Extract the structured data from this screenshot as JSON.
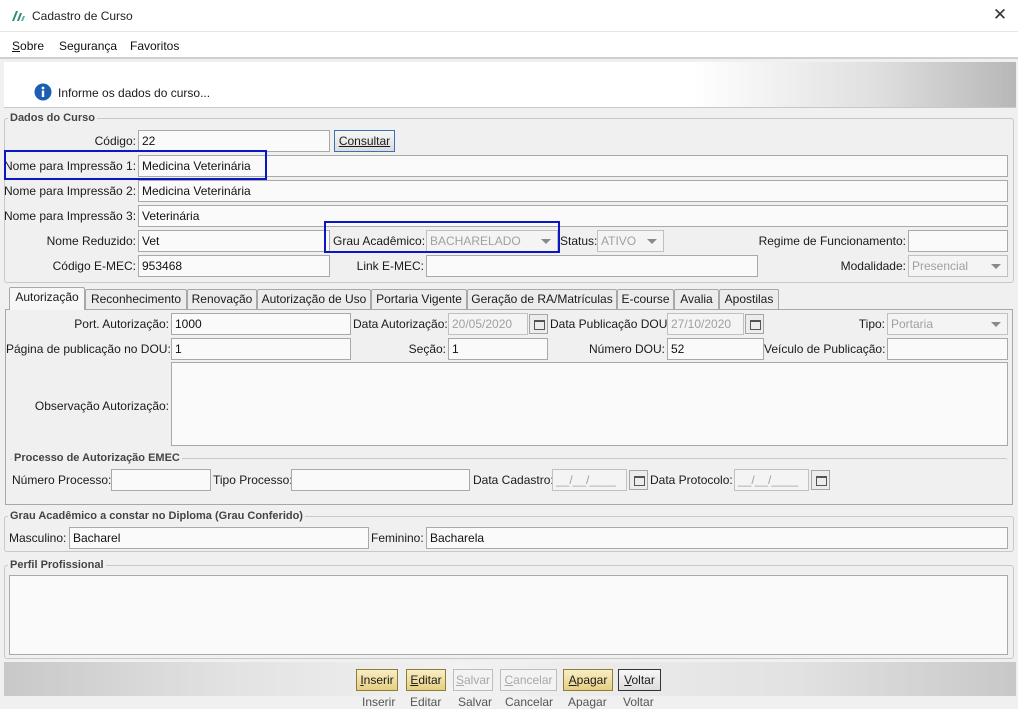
{
  "window": {
    "title": "Cadastro de Curso",
    "close_symbol": "✕"
  },
  "menu": [
    {
      "first": "S",
      "rest": "obre"
    },
    {
      "first": "",
      "rest": "Segurança"
    },
    {
      "first": "",
      "rest": "Favoritos"
    }
  ],
  "info": {
    "message": "Informe os dados do curso..."
  },
  "dados_curso": {
    "group_title": "Dados do Curso",
    "codigo_label": "Código:",
    "codigo": "22",
    "consultar_button": "Consultar",
    "nome1_label": "Nome para Impressão 1:",
    "nome1": "Medicina Veterinária",
    "nome2_label": "Nome para Impressão 2:",
    "nome2": "Medicina Veterinária",
    "nome3_label": "Nome para Impressão 3:",
    "nome3": "Veterinária",
    "nome_reduzido_label": "Nome Reduzido:",
    "nome_reduzido": "Vet",
    "grau_label": "Grau Acadêmico:",
    "grau": "BACHARELADO",
    "status_label": "Status:",
    "status": "ATIVO",
    "regime_label": "Regime de Funcionamento:",
    "regime": "",
    "codigo_emec_label": "Código E-MEC:",
    "codigo_emec": "953468",
    "link_emec_label": "Link E-MEC:",
    "link_emec": "",
    "modalidade_label": "Modalidade:",
    "modalidade": "Presencial"
  },
  "tabs": [
    "Autorização",
    "Reconhecimento",
    "Renovação",
    "Autorização de Uso",
    "Portaria Vigente",
    "Geração de RA/Matrículas",
    "E-course",
    "Avalia",
    "Apostilas"
  ],
  "autorizacao": {
    "port_label": "Port. Autorização:",
    "port": "1000",
    "data_aut_label": "Data Autorização:",
    "data_aut": "20/05/2020",
    "data_pub_label": "Data Publicação DOU:",
    "data_pub": "27/10/2020",
    "tipo_label": "Tipo:",
    "tipo": "Portaria",
    "pagina_label": "Página de publicação no DOU:",
    "pagina": "1",
    "secao_label": "Seção:",
    "secao": "1",
    "numero_dou_label": "Número DOU:",
    "numero_dou": "52",
    "veiculo_label": "Veículo de Publicação:",
    "veiculo": "",
    "obs_label": "Observação Autorização:",
    "processo_title": "Processo de Autorização EMEC",
    "num_proc_label": "Número Processo:",
    "num_proc": "",
    "tipo_proc_label": "Tipo Processo:",
    "tipo_proc": "",
    "data_cad_label": "Data Cadastro:",
    "data_cad_placeholder": "__/__/____",
    "data_prot_label": "Data Protocolo:",
    "data_prot_placeholder": "__/__/____"
  },
  "grau_diploma": {
    "title": "Grau Acadêmico a constar no Diploma (Grau Conferido)",
    "masc_label": "Masculino:",
    "masc": "Bacharel",
    "fem_label": "Feminino:",
    "fem": "Bacharela"
  },
  "perfil": {
    "title": "Perfil Profissional"
  },
  "actions": [
    {
      "first": "I",
      "rest": "nserir"
    },
    {
      "first": "E",
      "rest": "ditar"
    },
    {
      "first": "S",
      "rest": "alvar"
    },
    {
      "first": "C",
      "rest": "ancelar"
    },
    {
      "first": "A",
      "rest": "pagar"
    },
    {
      "first": "V",
      "rest": "oltar"
    }
  ],
  "ghost_buttons": [
    "Inserir",
    "Editar",
    "Salvar",
    "Cancelar",
    "Apagar",
    "Voltar"
  ],
  "colors": {
    "highlight": "#0b16c4",
    "info_icon": "#1a5fb4",
    "action_button": "#e6cf82",
    "logo": "#2a8a7a"
  }
}
